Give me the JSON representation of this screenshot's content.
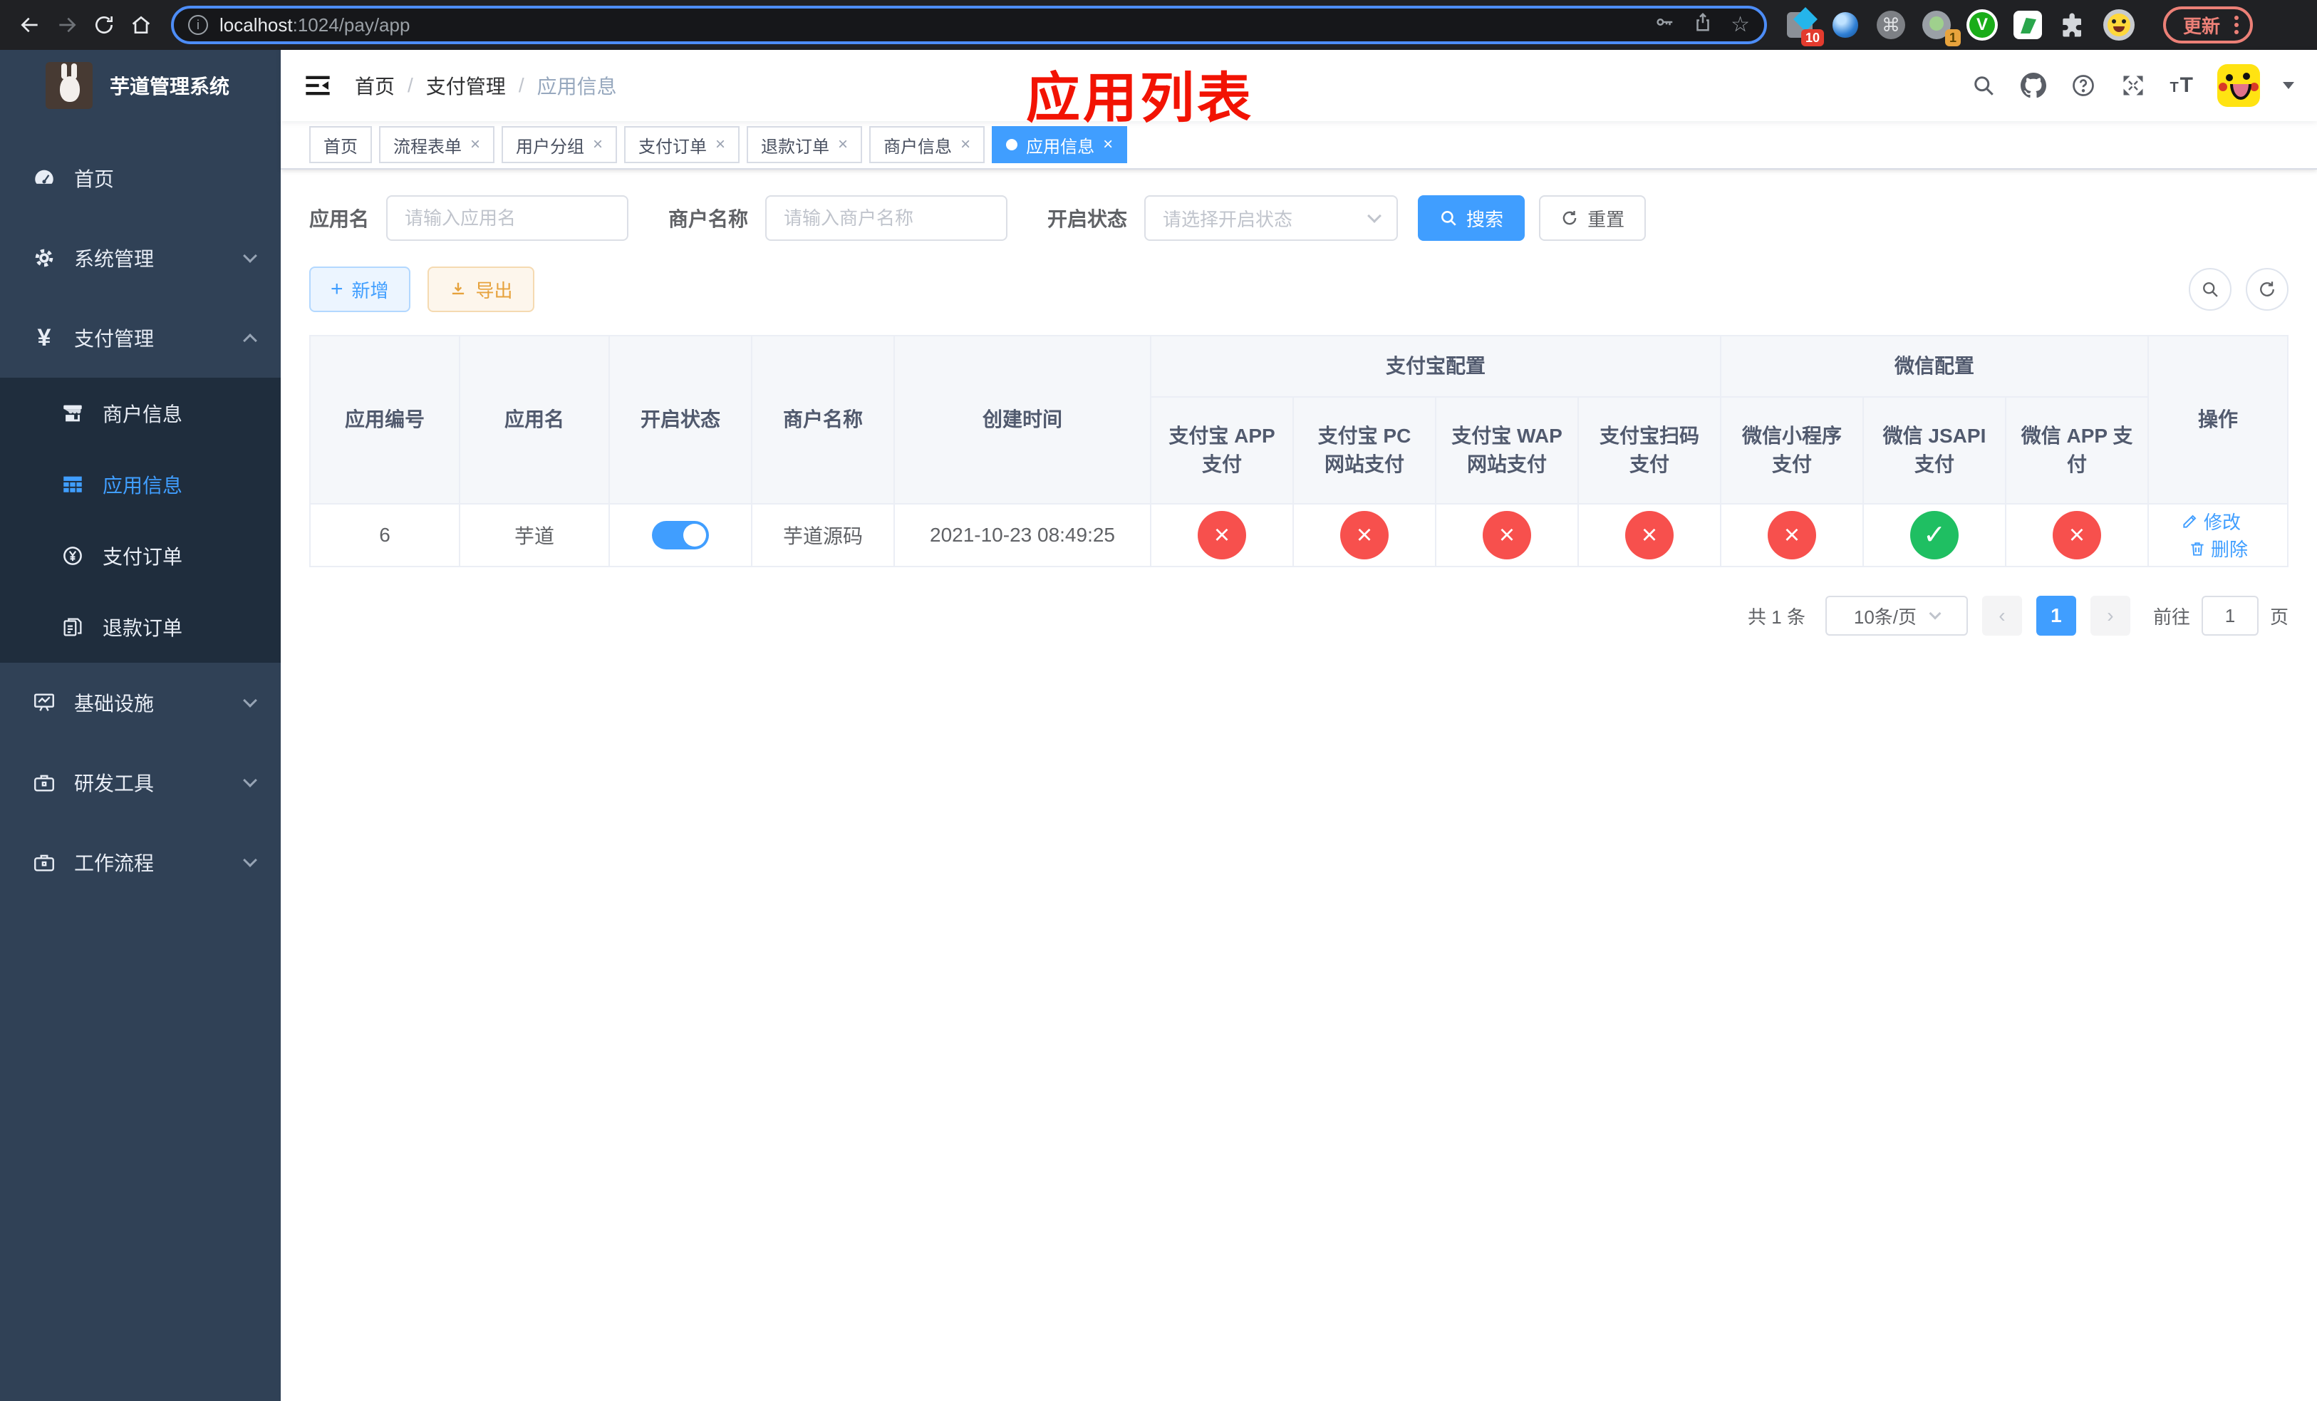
{
  "browser": {
    "url": {
      "host": "localhost",
      "path": ":1024/pay/app"
    },
    "update_label": "更新",
    "ext_badge_ten": "10",
    "ext_badge_one": "1",
    "command_glyph": "⌘"
  },
  "sidebar": {
    "title": "芋道管理系统",
    "menu": [
      {
        "label": "首页"
      },
      {
        "label": "系统管理"
      },
      {
        "label": "支付管理"
      },
      {
        "label": "基础设施"
      },
      {
        "label": "研发工具"
      },
      {
        "label": "工作流程"
      }
    ],
    "submenu": [
      {
        "label": "商户信息"
      },
      {
        "label": "应用信息"
      },
      {
        "label": "支付订单"
      },
      {
        "label": "退款订单"
      }
    ],
    "yen_glyph": "¥"
  },
  "navbar": {
    "breadcrumb": [
      "首页",
      "支付管理",
      "应用信息"
    ],
    "separator": "/"
  },
  "annotation": {
    "title": "应用列表"
  },
  "tabs": [
    {
      "label": "首页"
    },
    {
      "label": "流程表单"
    },
    {
      "label": "用户分组"
    },
    {
      "label": "支付订单"
    },
    {
      "label": "退款订单"
    },
    {
      "label": "商户信息"
    },
    {
      "label": "应用信息"
    }
  ],
  "filters": {
    "app_name": {
      "label": "应用名",
      "placeholder": "请输入应用名",
      "value": ""
    },
    "merchant_name": {
      "label": "商户名称",
      "placeholder": "请输入商户名称",
      "value": ""
    },
    "status": {
      "label": "开启状态",
      "placeholder": "请选择开启状态",
      "value": ""
    },
    "search_label": "搜索",
    "reset_label": "重置"
  },
  "toolbar": {
    "add_label": "新增",
    "export_label": "导出"
  },
  "table": {
    "columns": [
      "应用编号",
      "应用名",
      "开启状态",
      "商户名称",
      "创建时间"
    ],
    "groups": {
      "alipay": "支付宝配置",
      "wechat": "微信配置"
    },
    "sub_columns": [
      "支付宝 APP 支付",
      "支付宝 PC 网站支付",
      "支付宝 WAP 网站支付",
      "支付宝扫码支付",
      "微信小程序支付",
      "微信 JSAPI 支付",
      "微信 APP 支付"
    ],
    "action_column": "操作",
    "rows": [
      {
        "id": "6",
        "name": "芋道",
        "enabled": true,
        "merchant": "芋道源码",
        "created_at": "2021-10-23 08:49:25",
        "statuses": [
          "fail",
          "fail",
          "fail",
          "fail",
          "fail",
          "success",
          "fail"
        ],
        "actions": {
          "edit": "修改",
          "delete": "删除"
        }
      }
    ]
  },
  "pagination": {
    "total_text": "共 1 条",
    "page_size": "10条/页",
    "current_page": "1",
    "prev_glyph": "‹",
    "next_glyph": "›",
    "goto_label": "前往",
    "goto_value": "1",
    "page_suffix": "页"
  },
  "colors": {
    "primary": "#409eff",
    "success": "#1fbf62",
    "danger": "#f7504d",
    "warning": "#e6a23c"
  }
}
